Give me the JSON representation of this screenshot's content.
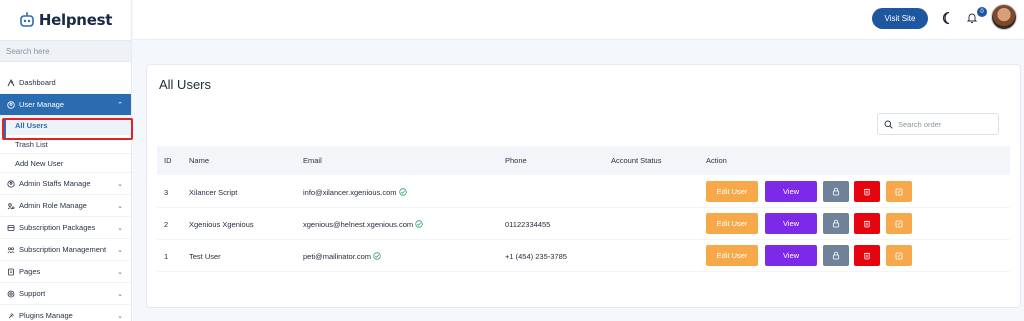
{
  "app": {
    "name": "Helpnest"
  },
  "sidebar": {
    "search_placeholder": "Search here",
    "items": [
      {
        "label": "Dashboard"
      },
      {
        "label": "User Manage"
      },
      {
        "label": "Admin Staffs Manage"
      },
      {
        "label": "Admin Role Manage"
      },
      {
        "label": "Subscription Packages"
      },
      {
        "label": "Subscription Management"
      },
      {
        "label": "Pages"
      },
      {
        "label": "Support"
      },
      {
        "label": "Plugins Manage"
      }
    ],
    "sub_items": [
      {
        "label": "All Users"
      },
      {
        "label": "Trash List"
      },
      {
        "label": "Add New User"
      }
    ]
  },
  "topbar": {
    "visit_site": "Visit Site",
    "notification_count": "0"
  },
  "main": {
    "title": "All Users",
    "search_placeholder": "Search order",
    "columns": [
      "ID",
      "Name",
      "Email",
      "Phone",
      "Account Status",
      "Action"
    ],
    "rows": [
      {
        "id": "3",
        "name": "Xilancer Script",
        "email": "info@xilancer.xgenious.com",
        "phone": "",
        "status": ""
      },
      {
        "id": "2",
        "name": "Xgenious Xgenious",
        "email": "xgenious@helnest.xgenious.com",
        "phone": "01122334455",
        "status": ""
      },
      {
        "id": "1",
        "name": "Test User",
        "email": "peti@mailinator.com",
        "phone": "+1 (454) 235-3785",
        "status": ""
      }
    ],
    "actions": {
      "edit": "Edit User",
      "view": "View"
    }
  },
  "colors": {
    "primary": "#2b6cb0",
    "edit": "#f7a84b",
    "view": "#7c2ae8",
    "lock": "#6f8299",
    "delete": "#e5050f"
  }
}
